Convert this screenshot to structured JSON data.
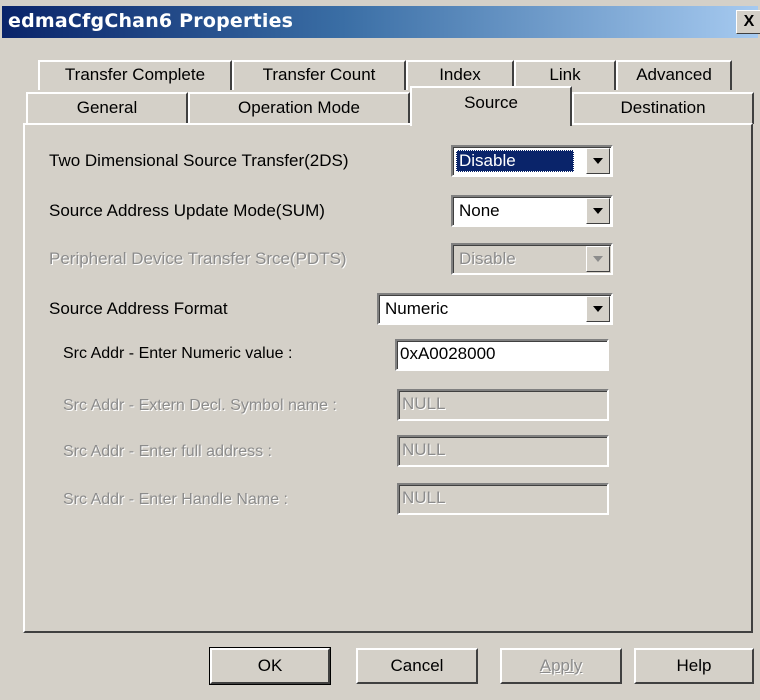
{
  "window": {
    "title": "edmaCfgChan6 Properties",
    "close_glyph": "X"
  },
  "tabs_row1": [
    {
      "label": "Transfer Complete"
    },
    {
      "label": "Transfer Count"
    },
    {
      "label": "Index"
    },
    {
      "label": "Link"
    },
    {
      "label": "Advanced"
    }
  ],
  "tabs_row2": [
    {
      "label": "General"
    },
    {
      "label": "Operation Mode"
    },
    {
      "label": "Source",
      "active": true
    },
    {
      "label": "Destination"
    }
  ],
  "source": {
    "two_dim": {
      "label": "Two Dimensional Source Transfer(2DS)",
      "value": "Disable"
    },
    "sum": {
      "label": "Source Address Update Mode(SUM)",
      "value": "None"
    },
    "pdts": {
      "label": "Peripheral Device Transfer Srce(PDTS)",
      "value": "Disable"
    },
    "format": {
      "label": "Source Address Format",
      "value": "Numeric"
    },
    "numeric": {
      "label": "Src Addr - Enter Numeric value :",
      "value": "0xA0028000"
    },
    "extern": {
      "label": "Src Addr - Extern Decl. Symbol name :",
      "value": "NULL"
    },
    "full": {
      "label": "Src Addr - Enter full address :",
      "value": "NULL"
    },
    "handle": {
      "label": "Src Addr - Enter Handle Name :",
      "value": "NULL"
    }
  },
  "buttons": {
    "ok": "OK",
    "cancel": "Cancel",
    "apply": "Apply",
    "help": "Help"
  },
  "colors": {
    "title_start": "#0a246a",
    "title_end": "#a6caf0",
    "face": "#d4d0c8",
    "selection": "#0a246a",
    "disabled_text": "#8c8c8c"
  }
}
